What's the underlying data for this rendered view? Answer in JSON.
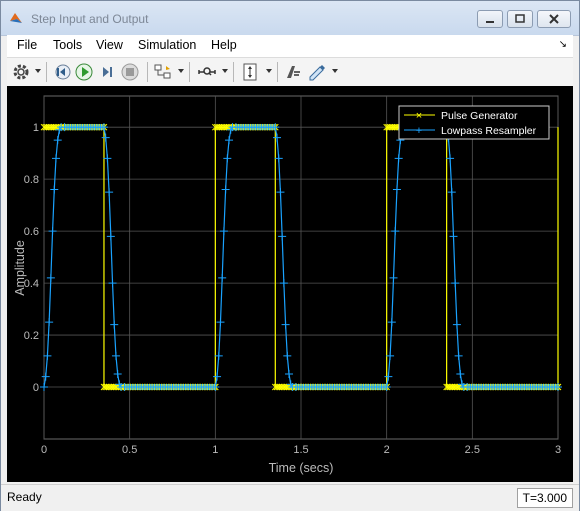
{
  "window": {
    "title": "Step Input and Output"
  },
  "menu": {
    "items": [
      "File",
      "Tools",
      "View",
      "Simulation",
      "Help"
    ],
    "dock_glyph": "↘"
  },
  "toolbar": {
    "icons": [
      "gear-icon",
      "step-back-icon",
      "run-icon",
      "step-forward-icon",
      "stop-icon",
      "signal-select-icon",
      "zoom-icon",
      "scale-axes-icon",
      "highlight-icon",
      "edit-icon"
    ]
  },
  "chart_data": {
    "type": "line",
    "xlabel": "Time (secs)",
    "ylabel": "Amplitude",
    "xlim": [
      0,
      3
    ],
    "ylim": [
      -0.2,
      1.12
    ],
    "x_ticks": [
      "0",
      "0.5",
      "1",
      "1.5",
      "2",
      "2.5",
      "3"
    ],
    "y_ticks": [
      "0",
      "0.2",
      "0.4",
      "0.6",
      "0.8",
      "1"
    ],
    "grid": true,
    "legend_position": "top-right",
    "colors": {
      "pulse": "#ffff00",
      "resampler": "#1aa3ff",
      "grid": "#555555",
      "text": "#bbbbbb"
    },
    "series": [
      {
        "name": "Pulse Generator",
        "marker": "x",
        "x": [
          0,
          0.35,
          0.35,
          1,
          1,
          1.35,
          1.35,
          2,
          2,
          2.35,
          2.35,
          3,
          3
        ],
        "y": [
          1,
          1,
          0,
          0,
          1,
          1,
          0,
          0,
          1,
          1,
          0,
          0,
          1
        ]
      },
      {
        "name": "Lowpass Resampler",
        "marker": "+",
        "x": [
          0,
          0.01,
          0.02,
          0.03,
          0.04,
          0.05,
          0.06,
          0.07,
          0.08,
          0.09,
          0.1,
          0.12,
          0.35,
          0.36,
          0.37,
          0.38,
          0.39,
          0.4,
          0.41,
          0.42,
          0.43,
          0.44,
          0.45,
          0.47,
          1,
          1.01,
          1.02,
          1.03,
          1.04,
          1.05,
          1.06,
          1.07,
          1.08,
          1.09,
          1.1,
          1.12,
          1.35,
          1.36,
          1.37,
          1.38,
          1.39,
          1.4,
          1.41,
          1.42,
          1.43,
          1.44,
          1.45,
          1.47,
          2,
          2.01,
          2.02,
          2.03,
          2.04,
          2.05,
          2.06,
          2.07,
          2.08,
          2.09,
          2.1,
          2.12,
          2.35,
          2.36,
          2.37,
          2.38,
          2.39,
          2.4,
          2.41,
          2.42,
          2.43,
          2.44,
          2.45,
          2.47,
          3
        ],
        "y": [
          0,
          0.04,
          0.12,
          0.25,
          0.42,
          0.6,
          0.76,
          0.88,
          0.95,
          0.99,
          1,
          1,
          1,
          0.96,
          0.88,
          0.75,
          0.58,
          0.4,
          0.24,
          0.12,
          0.05,
          0.01,
          0,
          0,
          0,
          0.04,
          0.12,
          0.25,
          0.42,
          0.6,
          0.76,
          0.88,
          0.95,
          0.99,
          1,
          1,
          1,
          0.96,
          0.88,
          0.75,
          0.58,
          0.4,
          0.24,
          0.12,
          0.05,
          0.01,
          0,
          0,
          0,
          0.04,
          0.12,
          0.25,
          0.42,
          0.6,
          0.76,
          0.88,
          0.95,
          0.99,
          1,
          1,
          1,
          0.96,
          0.88,
          0.75,
          0.58,
          0.4,
          0.24,
          0.12,
          0.05,
          0.01,
          0,
          0,
          0
        ]
      }
    ]
  },
  "status": {
    "text": "Ready",
    "time": "T=3.000"
  }
}
